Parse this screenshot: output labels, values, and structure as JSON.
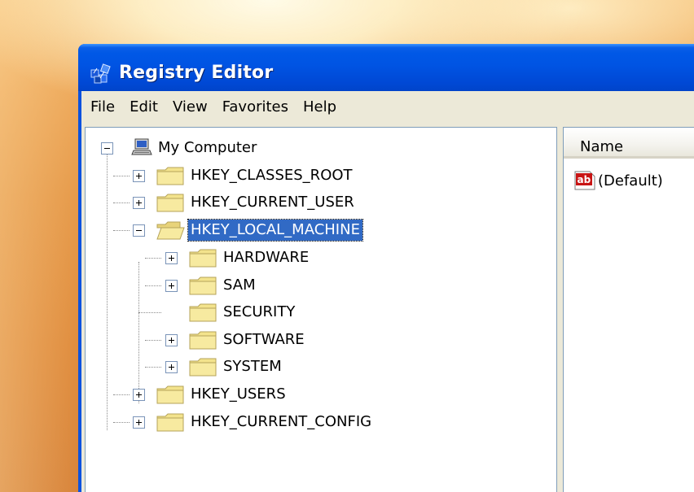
{
  "window": {
    "title": "Registry Editor"
  },
  "menubar": {
    "items": [
      {
        "label": "File"
      },
      {
        "label": "Edit"
      },
      {
        "label": "View"
      },
      {
        "label": "Favorites"
      },
      {
        "label": "Help"
      }
    ]
  },
  "tree": {
    "root": {
      "label": "My Computer",
      "icon": "computer-icon",
      "state": "expanded"
    },
    "nodes": [
      {
        "label": "HKEY_CLASSES_ROOT",
        "icon": "folder-icon",
        "state": "collapsed"
      },
      {
        "label": "HKEY_CURRENT_USER",
        "icon": "folder-icon",
        "state": "collapsed"
      },
      {
        "label": "HKEY_LOCAL_MACHINE",
        "icon": "folder-open-icon",
        "state": "expanded",
        "selected": true
      },
      {
        "label": "HARDWARE",
        "icon": "folder-icon",
        "state": "collapsed"
      },
      {
        "label": "SAM",
        "icon": "folder-icon",
        "state": "collapsed"
      },
      {
        "label": "SECURITY",
        "icon": "folder-icon",
        "state": "leaf"
      },
      {
        "label": "SOFTWARE",
        "icon": "folder-icon",
        "state": "collapsed"
      },
      {
        "label": "SYSTEM",
        "icon": "folder-icon",
        "state": "collapsed"
      },
      {
        "label": "HKEY_USERS",
        "icon": "folder-icon",
        "state": "collapsed"
      },
      {
        "label": "HKEY_CURRENT_CONFIG",
        "icon": "folder-icon",
        "state": "collapsed"
      }
    ]
  },
  "list": {
    "columns": [
      {
        "label": "Name"
      }
    ],
    "rows": [
      {
        "name": "(Default)",
        "icon": "string-value-icon"
      }
    ]
  },
  "colors": {
    "titlebar": "#0054e3",
    "selection": "#316ac5",
    "folder": "#f3e38c",
    "chrome": "#ece9d8"
  }
}
